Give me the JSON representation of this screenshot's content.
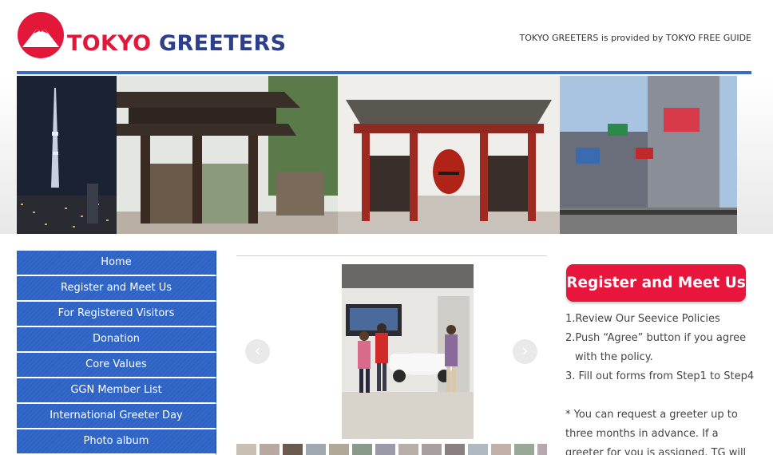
{
  "header": {
    "title_part1": "TOKYO",
    "title_part2": "GREETERS",
    "tagline": "TOKYO GREETERS is provided by TOKYO FREE GUIDE",
    "logo_icon": "mount-fuji-logo-icon"
  },
  "colors": {
    "brand_red": "#e3173a",
    "brand_blue": "#2c3e8c",
    "nav_blue": "#2e64c8",
    "rule_blue": "#3a6bc9",
    "register_red": "#e8153c"
  },
  "banner": {
    "photos": [
      "tokyo-skytree-night",
      "temple-gate",
      "kaminarimon-gate",
      "shibuya-crossing"
    ]
  },
  "nav": {
    "items": [
      {
        "label": "Home"
      },
      {
        "label": "Register and Meet Us"
      },
      {
        "label": "For Registered Visitors"
      },
      {
        "label": "Donation"
      },
      {
        "label": "Core Values"
      },
      {
        "label": "GGN Member List"
      },
      {
        "label": "International Greeter Day"
      },
      {
        "label": "Photo album"
      }
    ]
  },
  "slideshow": {
    "prev_icon": "chevron-left-icon",
    "next_icon": "chevron-right-icon",
    "prev_glyph": "‹",
    "next_glyph": "›",
    "thumb_count": 14
  },
  "panel": {
    "register_label": "Register and Meet Us",
    "steps": [
      "1.Review Our Seevice Policies",
      "2.Push “Agree” button if you agree",
      "with the policy.",
      "3. Fill out forms from Step1 to Step4"
    ],
    "note": [
      "* You can request a greeter up to",
      "three months in advance. If a",
      "greeter for you is assigned, TG will"
    ]
  }
}
